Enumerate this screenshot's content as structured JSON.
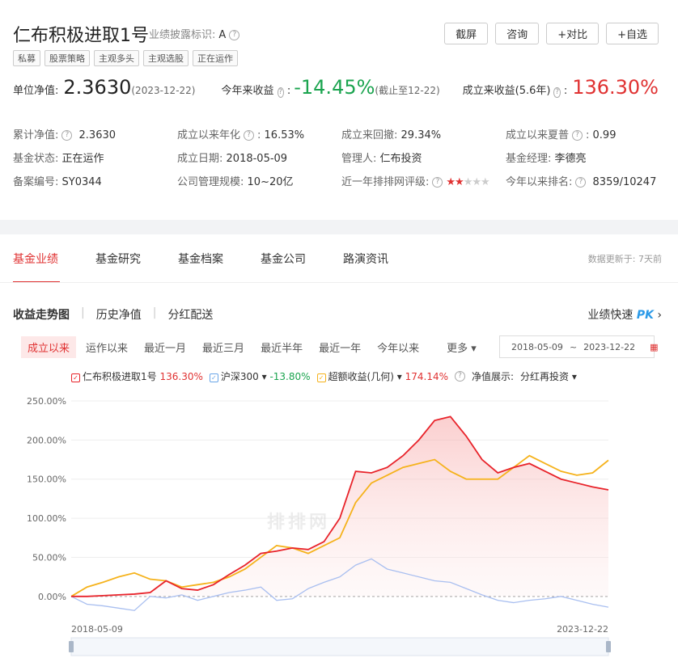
{
  "header": {
    "title": "仁布积极进取1号",
    "disclosure_label": "业绩披露标识:",
    "disclosure_value": "A",
    "tags": [
      "私募",
      "股票策略",
      "主观多头",
      "主观选股",
      "正在运作"
    ],
    "buttons": [
      "截屏",
      "咨询",
      "+对比",
      "+自选"
    ]
  },
  "nav": {
    "label": "单位净值:",
    "value": "2.3630",
    "date": "(2023-12-22)",
    "ytd_label": "今年来收益",
    "ytd_value": "-14.45%",
    "ytd_note": "(截止至12-22)",
    "since_label": "成立来收益(5.6年)",
    "since_value": "136.30%"
  },
  "info": [
    {
      "label": "累计净值:",
      "value": "2.3630",
      "help": true
    },
    {
      "label": "成立以来年化",
      "value": "16.53%",
      "help": true,
      "color": "red",
      "colon": true
    },
    {
      "label": "成立来回撤:",
      "value": "29.34%"
    },
    {
      "label": "成立以来夏普",
      "value": "0.99",
      "help": true,
      "colon": true
    },
    {
      "label": "基金状态:",
      "value": "正在运作"
    },
    {
      "label": "成立日期:",
      "value": "2018-05-09"
    },
    {
      "label": "管理人:",
      "value": "仁布投资",
      "color": "blue"
    },
    {
      "label": "基金经理:",
      "value": "李德亮",
      "color": "blue"
    },
    {
      "label": "备案编号:",
      "value": "SY0344"
    },
    {
      "label": "公司管理规模:",
      "value": "10~20亿"
    },
    {
      "label": "近一年排排网评级:",
      "stars": 2,
      "help": true
    },
    {
      "label": "今年以来排名:",
      "value": "8359/10247",
      "help": true
    }
  ],
  "tabs": [
    "基金业绩",
    "基金研究",
    "基金档案",
    "基金公司",
    "路演资讯"
  ],
  "updated": "数据更新于: 7天前",
  "subtabs": [
    "收益走势图",
    "历史净值",
    "分红配送"
  ],
  "pk_label": "业绩快速",
  "pk_brand": "PK",
  "ranges": [
    "成立以来",
    "运作以来",
    "最近一月",
    "最近三月",
    "最近半年",
    "最近一年",
    "今年以来",
    "更多"
  ],
  "date_from": "2018-05-09",
  "date_sep": "~",
  "date_to": "2023-12-22",
  "legend": {
    "fund_name": "仁布积极进取1号",
    "fund_value": "136.30%",
    "index_name": "沪深300",
    "index_value": "-13.80%",
    "excess_name": "超额收益(几何)",
    "excess_value": "174.14%",
    "display_label": "净值展示:",
    "display_value": "分红再投资"
  },
  "watermark": "排排网",
  "colors": {
    "fund": "#e8232a",
    "index": "#a9bff0",
    "excess": "#f5b21b",
    "accent": "#e03232"
  },
  "chart_data": {
    "type": "line",
    "x_start": "2018-05-09",
    "x_end": "2023-12-22",
    "ylim": [
      -25,
      250
    ],
    "yticks": [
      "250.00%",
      "200.00%",
      "150.00%",
      "100.00%",
      "50.00%",
      "0.00%"
    ],
    "ytick_values": [
      250,
      200,
      150,
      100,
      50,
      0
    ],
    "x": [
      0,
      2,
      4,
      6,
      8,
      10,
      12,
      14,
      16,
      18,
      20,
      22,
      24,
      26,
      28,
      30,
      32,
      34,
      36,
      38,
      40,
      42,
      44,
      46,
      48,
      50,
      52,
      54,
      56,
      58,
      60,
      62,
      64,
      66,
      68
    ],
    "series": [
      {
        "name": "仁布积极进取1号",
        "values": [
          0,
          0,
          1,
          2,
          3,
          5,
          20,
          10,
          8,
          15,
          28,
          40,
          55,
          58,
          62,
          60,
          70,
          100,
          160,
          158,
          165,
          180,
          200,
          225,
          230,
          205,
          175,
          158,
          165,
          170,
          160,
          150,
          145,
          140,
          136.3
        ]
      },
      {
        "name": "沪深300",
        "values": [
          0,
          -10,
          -12,
          -15,
          -18,
          0,
          -2,
          2,
          -5,
          0,
          5,
          8,
          12,
          -5,
          -3,
          10,
          18,
          25,
          40,
          48,
          35,
          30,
          25,
          20,
          18,
          10,
          2,
          -5,
          -8,
          -5,
          -3,
          0,
          -5,
          -10,
          -13.8
        ]
      },
      {
        "name": "超额收益(几何)",
        "values": [
          0,
          12,
          18,
          25,
          30,
          22,
          20,
          12,
          15,
          18,
          25,
          35,
          50,
          65,
          62,
          55,
          65,
          75,
          120,
          145,
          155,
          165,
          170,
          175,
          160,
          150,
          150,
          150,
          165,
          180,
          170,
          160,
          155,
          158,
          174.14
        ]
      }
    ]
  }
}
